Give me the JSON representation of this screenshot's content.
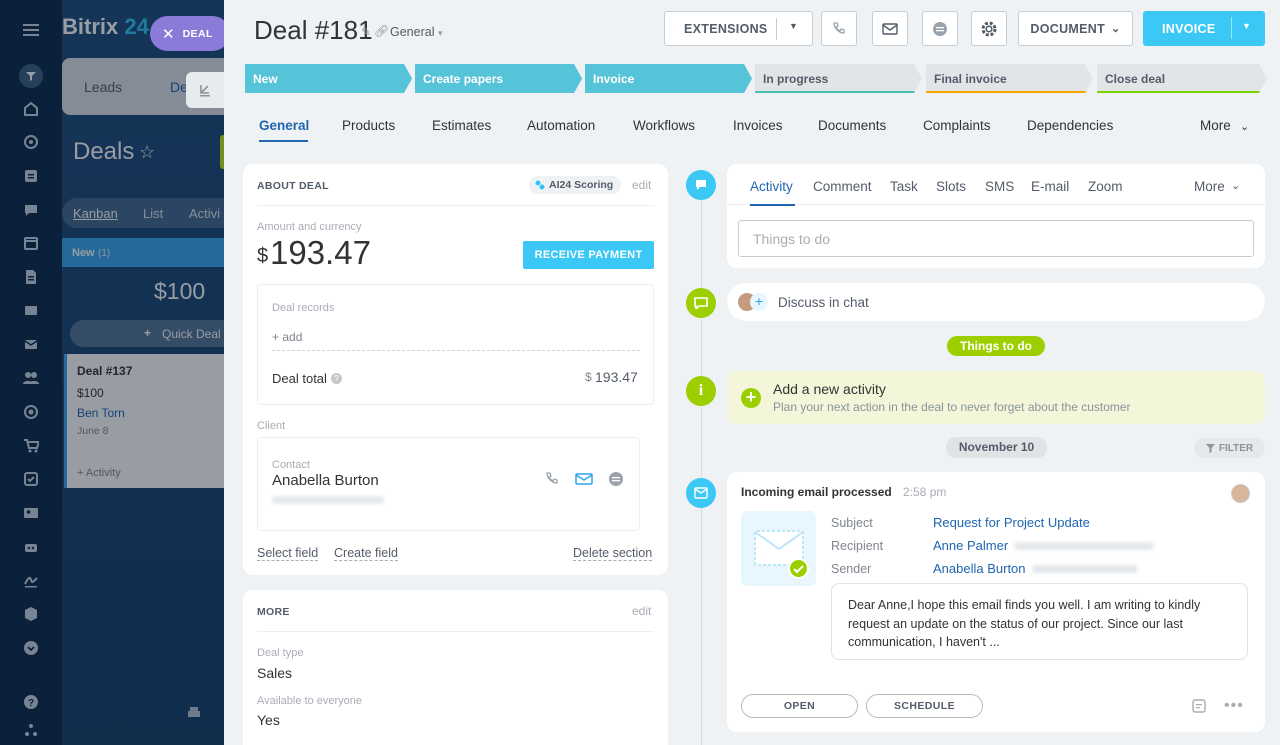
{
  "app": {
    "logo": "Bitrix",
    "logo_num": "24",
    "close_chip": "DEAL"
  },
  "background": {
    "tabs": [
      "Leads",
      "De"
    ],
    "title": "Deals",
    "views": [
      "Kanban",
      "List",
      "Activi"
    ],
    "column": {
      "name": "New",
      "count": "(1)",
      "sum": "$100",
      "quick": "Quick Deal"
    },
    "card": {
      "title": "Deal #137",
      "amount": "$100",
      "person": "Ben Torn",
      "date": "June 8",
      "activity": "+ Activity"
    }
  },
  "deal": {
    "title": "Deal #181",
    "category": "General",
    "buttons": {
      "extensions": "EXTENSIONS",
      "document": "DOCUMENT",
      "invoice": "INVOICE"
    },
    "stages": [
      {
        "label": "New",
        "color": "#55c3d8",
        "active": true
      },
      {
        "label": "Create papers",
        "color": "#55c3d8",
        "active": true
      },
      {
        "label": "Invoice",
        "color": "#55c3d8",
        "active": true
      },
      {
        "label": "In progress",
        "color": "#e2e5e8",
        "bar": "#47c2b5",
        "active": false
      },
      {
        "label": "Final invoice",
        "color": "#e2e5e8",
        "bar": "#f7a700",
        "active": false
      },
      {
        "label": "Close deal",
        "color": "#e2e5e8",
        "bar": "#7bd500",
        "active": false
      }
    ],
    "tabs": [
      "General",
      "Products",
      "Estimates",
      "Automation",
      "Workflows",
      "Invoices",
      "Documents",
      "Complaints",
      "Dependencies",
      "More"
    ]
  },
  "about": {
    "header": "ABOUT DEAL",
    "ai_badge": "AI24 Scoring",
    "edit": "edit",
    "amount_label": "Amount and currency",
    "currency": "$",
    "amount": "193.47",
    "receive_btn": "RECEIVE PAYMENT",
    "records_label": "Deal records",
    "add": "+ add",
    "total_label": "Deal total",
    "total_currency": "$",
    "total_value": "193.47",
    "client_label": "Client",
    "contact_label": "Contact",
    "contact_name": "Anabella Burton",
    "select_field": "Select field",
    "create_field": "Create field",
    "delete_section": "Delete section"
  },
  "more": {
    "header": "MORE",
    "edit": "edit",
    "type_label": "Deal type",
    "type_value": "Sales",
    "avail_label": "Available to everyone",
    "avail_value": "Yes"
  },
  "activity": {
    "tabs": [
      "Activity",
      "Comment",
      "Task",
      "Slots",
      "SMS",
      "E-mail",
      "Zoom",
      "More"
    ],
    "placeholder": "Things to do",
    "discuss": "Discuss in chat",
    "todo_badge": "Things to do",
    "add_title": "Add a new activity",
    "add_sub": "Plan your next action in the deal to never forget about the customer",
    "date_badge": "November 10",
    "filter": "FILTER"
  },
  "email": {
    "title": "Incoming email processed",
    "time": "2:58 pm",
    "subject_label": "Subject",
    "subject": "Request for Project Update",
    "recipient_label": "Recipient",
    "recipient": "Anne Palmer",
    "sender_label": "Sender",
    "sender": "Anabella Burton",
    "body": "Dear Anne,I hope this email finds you well. I am writing to kindly request an update on the status of our project. Since our last communication, I haven't ...",
    "open": "OPEN",
    "schedule": "SCHEDULE"
  }
}
